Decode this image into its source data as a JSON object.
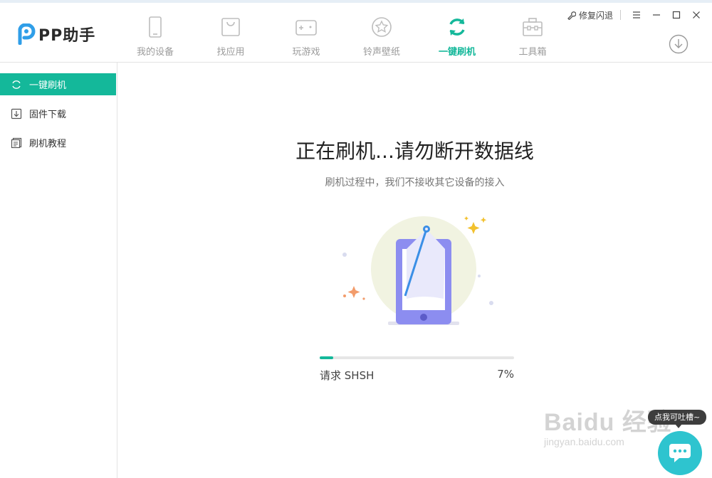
{
  "app": {
    "name": "PP助手",
    "brand_color": "#14b89a",
    "logo_color": "#2f9ee8"
  },
  "window": {
    "repair_label": "修复闪退",
    "controls": [
      "menu-icon",
      "minimize-icon",
      "maximize-icon",
      "close-icon"
    ]
  },
  "nav": {
    "items": [
      {
        "label": "我的设备",
        "icon": "phone-icon"
      },
      {
        "label": "找应用",
        "icon": "bag-icon"
      },
      {
        "label": "玩游戏",
        "icon": "gamepad-icon"
      },
      {
        "label": "铃声壁纸",
        "icon": "star-icon"
      },
      {
        "label": "一键刷机",
        "icon": "refresh-icon",
        "active": true
      },
      {
        "label": "工具箱",
        "icon": "toolbox-icon"
      }
    ],
    "download_icon": "download-icon"
  },
  "sidebar": {
    "items": [
      {
        "label": "一键刷机",
        "icon": "refresh-icon",
        "active": true
      },
      {
        "label": "固件下载",
        "icon": "download-icon"
      },
      {
        "label": "刷机教程",
        "icon": "document-icon"
      }
    ]
  },
  "main": {
    "title": "正在刷机...请勿断开数据线",
    "subtitle": "刷机过程中，我们不接收其它设备的接入",
    "progress": {
      "step": "请求 SHSH",
      "percent_text": "7%",
      "value": 0.07
    }
  },
  "feedback": {
    "tooltip": "点我可吐槽~"
  },
  "watermark": {
    "line1": "Baidu 经验",
    "line2": "jingyan.baidu.com"
  }
}
